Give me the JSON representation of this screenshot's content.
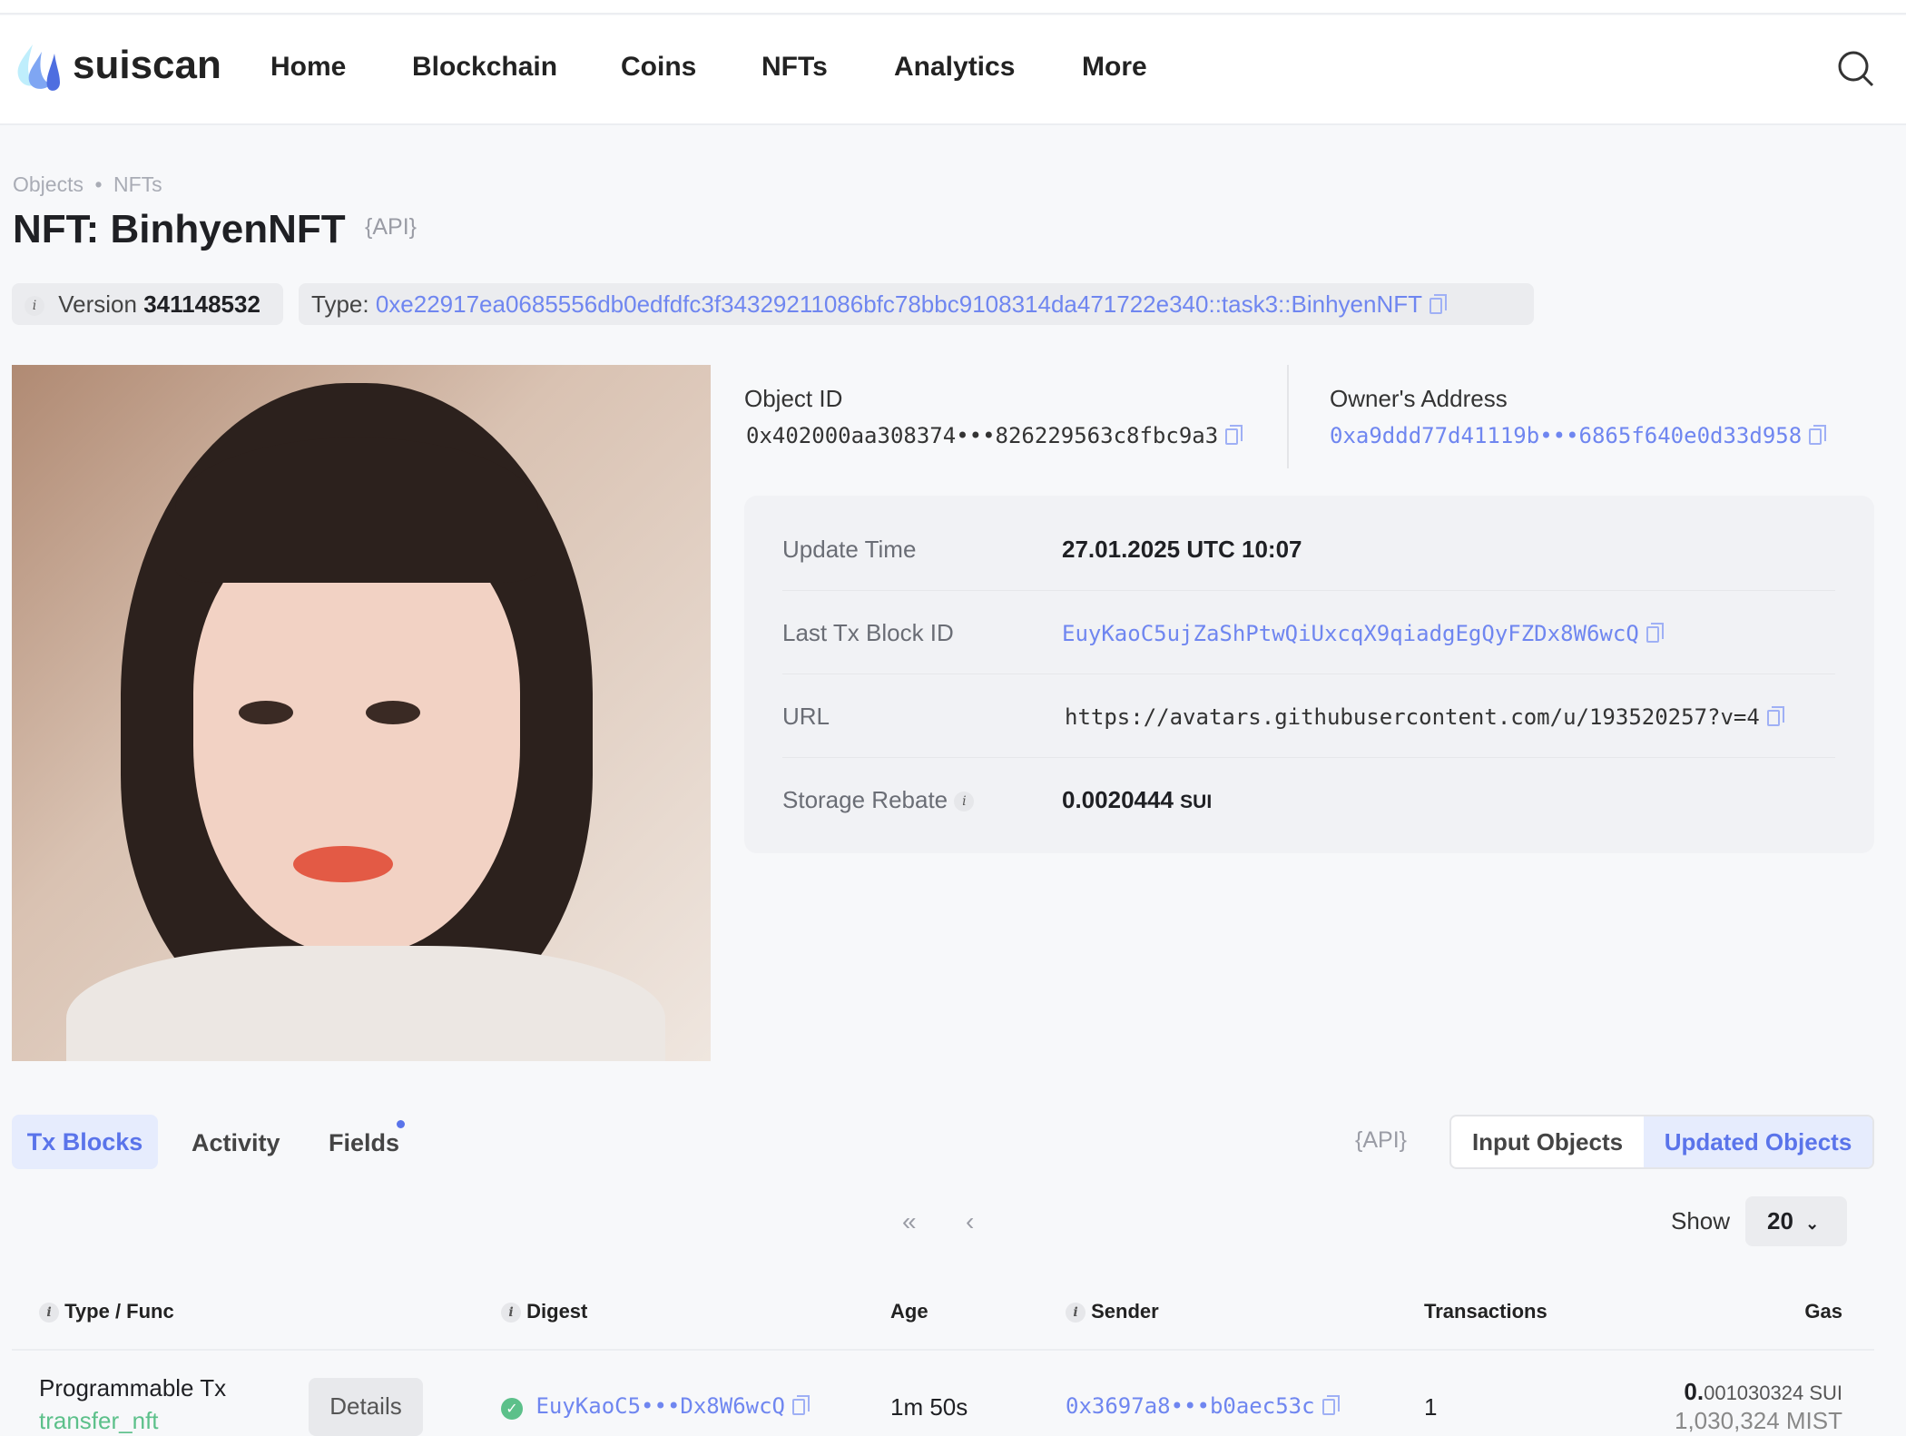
{
  "header": {
    "brand": "suiscan",
    "nav": [
      "Home",
      "Blockchain",
      "Coins",
      "NFTs",
      "Analytics",
      "More"
    ]
  },
  "breadcrumb": [
    "Objects",
    "NFTs"
  ],
  "title": "NFT: BinhyenNFT",
  "api_label": "API",
  "version": {
    "label": "Version",
    "value": "341148532"
  },
  "type": {
    "label": "Type:",
    "value": "0xe22917ea0685556db0edfdfc3f34329211086bfc78bbc9108314da471722e340::task3::BinhyenNFT"
  },
  "object_id": {
    "label": "Object ID",
    "value": "0x402000aa308374•••826229563c8fbc9a3"
  },
  "owner": {
    "label": "Owner's Address",
    "value": "0xa9ddd77d41119b•••6865f640e0d33d958"
  },
  "details": [
    {
      "label": "Update Time",
      "value": "27.01.2025 UTC 10:07"
    },
    {
      "label": "Last Tx Block ID",
      "value": "EuyKaoC5ujZaShPtwQiUxcqX9qiadgEgQyFZDx8W6wcQ"
    },
    {
      "label": "URL",
      "value": "https://avatars.githubusercontent.com/u/193520257?v=4"
    },
    {
      "label": "Storage Rebate",
      "value": "0.0020444",
      "unit": "SUI"
    }
  ],
  "tabs": [
    "Tx Blocks",
    "Activity",
    "Fields"
  ],
  "object_toggle": [
    "Input Objects",
    "Updated Objects"
  ],
  "show": {
    "label": "Show",
    "value": "20"
  },
  "table": {
    "headers": [
      "Type / Func",
      "Digest",
      "Age",
      "Sender",
      "Transactions",
      "Gas"
    ],
    "rows": [
      {
        "type": "Programmable Tx",
        "func": "transfer_nft",
        "details": "Details",
        "digest": "EuyKaoC5•••Dx8W6wcQ",
        "age": "1m 50s",
        "sender": "0x3697a8•••b0aec53c",
        "transactions": "1",
        "gas_lead": "0.",
        "gas_rest": "001030324 SUI",
        "gas_mist": "1,030,324 MIST"
      }
    ]
  },
  "colors": {
    "accent": "#6f86f0",
    "success": "#5cc08a"
  }
}
